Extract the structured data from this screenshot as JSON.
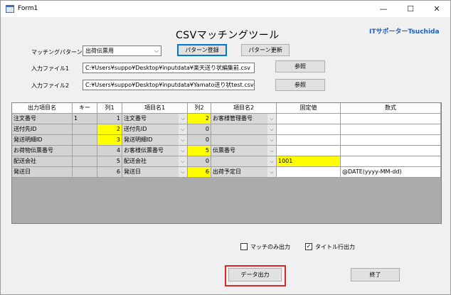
{
  "window": {
    "title": "Form1",
    "controls": {
      "minimize": "—",
      "maximize": "☐",
      "close": "✕"
    }
  },
  "app": {
    "title": "CSVマッチングツール",
    "brand": "ITサポーターTsuchida"
  },
  "pattern": {
    "label": "マッチングパターン",
    "selected": "出荷伝票用",
    "register_button": "パターン登録",
    "update_button": "パターン更新"
  },
  "inputs": {
    "file1_label": "入力ファイル1",
    "file1_value": "C:¥Users¥suppo¥Desktop¥inputdata¥楽天送り状編集前.csv",
    "file2_label": "入力ファイル2",
    "file2_value": "C:¥Users¥suppo¥Desktop¥inputdata¥Yamato送り状test.csv",
    "browse_label": "参照"
  },
  "grid": {
    "headers": [
      "出力項目名",
      "キー",
      "列1",
      "項目名1",
      "列2",
      "項目名2",
      "固定値",
      "数式"
    ],
    "rows": [
      {
        "name": "注文番号",
        "key": "1",
        "col1": "1",
        "item1": "注文番号",
        "col2": "2",
        "item2": "お客様管理番号",
        "fixed": "",
        "formula": ""
      },
      {
        "name": "送付先ID",
        "key": "",
        "col1": "2",
        "item1": "送付先ID",
        "col2": "0",
        "item2": "",
        "fixed": "",
        "formula": ""
      },
      {
        "name": "発送明細ID",
        "key": "",
        "col1": "3",
        "item1": "発送明細ID",
        "col2": "0",
        "item2": "",
        "fixed": "",
        "formula": ""
      },
      {
        "name": "お荷物伝票番号",
        "key": "",
        "col1": "4",
        "item1": "お客様伝票番号",
        "col2": "5",
        "item2": "伝票番号",
        "fixed": "",
        "formula": ""
      },
      {
        "name": "配送会社",
        "key": "",
        "col1": "5",
        "item1": "配送会社",
        "col2": "0",
        "item2": "",
        "fixed": "1001",
        "formula": ""
      },
      {
        "name": "発送日",
        "key": "",
        "col1": "6",
        "item1": "発送日",
        "col2": "6",
        "item2": "出荷予定日",
        "fixed": "",
        "formula": "@DATE(yyyy-MM-dd)"
      }
    ]
  },
  "options": {
    "match_only_label": "マッチのみ出力",
    "match_only_checked": false,
    "title_row_label": "タイトル行出力",
    "title_row_checked": true
  },
  "actions": {
    "export_button": "データ出力",
    "exit_button": "終了"
  },
  "colors": {
    "highlight_yellow": "#ffff00",
    "accent_blue": "#1c5fbf",
    "focus_red": "#d92a2a"
  }
}
